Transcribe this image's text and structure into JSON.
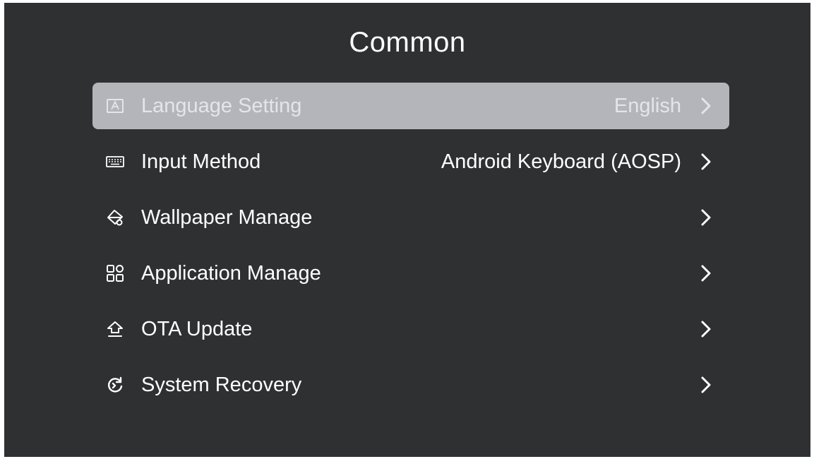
{
  "page": {
    "title": "Common"
  },
  "menu": {
    "items": [
      {
        "label": "Language Setting",
        "value": "English",
        "icon": "language-icon",
        "selected": true
      },
      {
        "label": "Input Method",
        "value": "Android Keyboard (AOSP)",
        "icon": "keyboard-icon",
        "selected": false
      },
      {
        "label": "Wallpaper Manage",
        "value": "",
        "icon": "wallpaper-icon",
        "selected": false
      },
      {
        "label": "Application Manage",
        "value": "",
        "icon": "apps-grid-icon",
        "selected": false
      },
      {
        "label": "OTA Update",
        "value": "",
        "icon": "ota-update-icon",
        "selected": false
      },
      {
        "label": "System Recovery",
        "value": "",
        "icon": "recovery-icon",
        "selected": false
      }
    ]
  },
  "colors": {
    "background": "#2f3032",
    "selected_row": "#b3b5ba",
    "text": "#ffffff"
  }
}
